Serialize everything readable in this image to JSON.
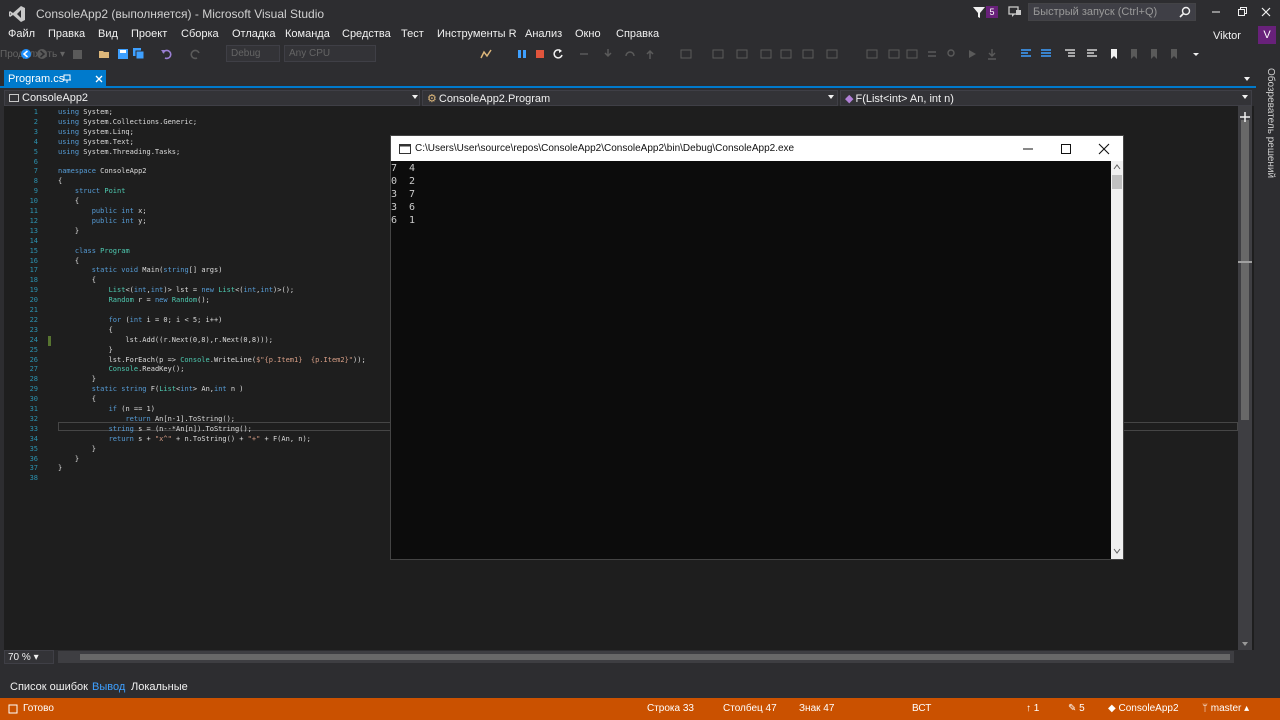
{
  "window": {
    "title": "ConsoleApp2 (выполняется) - Microsoft Visual Studio",
    "notification_count": "5",
    "quick_launch_placeholder": "Быстрый запуск (Ctrl+Q)"
  },
  "menu": {
    "items": [
      "Файл",
      "Правка",
      "Вид",
      "Проект",
      "Сборка",
      "Отладка",
      "Команда",
      "Средства",
      "Тест",
      "Инструменты R",
      "Анализ",
      "Окно",
      "Справка"
    ],
    "user": "Viktor",
    "avatar_letter": "V"
  },
  "toolbar": {
    "config": "Debug",
    "platform": "Any CPU",
    "continue_label": "Продолжить"
  },
  "editor": {
    "tab_label": "Program.cs",
    "nav_project": "ConsoleApp2",
    "nav_class": "ConsoleApp2.Program",
    "nav_member": "F(List<int> An, int n)",
    "zoom": "70 %"
  },
  "side_panel": {
    "label": "Обозреватель решений"
  },
  "bottom_tabs": [
    "Список ошибок",
    "Вывод",
    "Локальные"
  ],
  "status": {
    "ready": "Готово",
    "line": "Строка 33",
    "col": "Столбец 47",
    "char": "Знак 47",
    "mode": "ВСТ",
    "up_count": "1",
    "pen_count": "5",
    "repo": "ConsoleApp2",
    "branch": "master"
  },
  "console": {
    "title": "C:\\Users\\User\\source\\repos\\ConsoleApp2\\ConsoleApp2\\bin\\Debug\\ConsoleApp2.exe",
    "output": [
      "7  4",
      "0  2",
      "3  7",
      "3  6",
      "6  1"
    ]
  },
  "colors": {
    "accent": "#007acc",
    "status_bar": "#ca5100",
    "editor_bg": "#1e1e1e",
    "chrome_bg": "#2d2d30",
    "vs_purple": "#68217a"
  }
}
